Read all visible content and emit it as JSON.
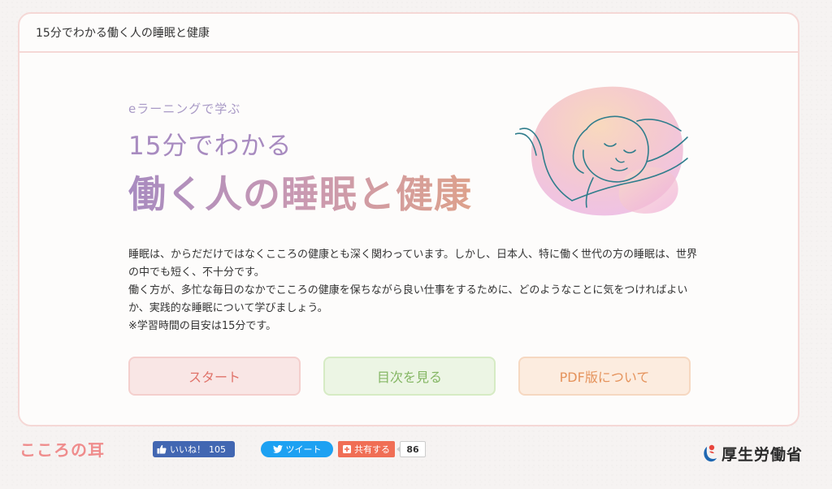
{
  "card": {
    "header_title": "15分でわかる働く人の睡眠と健康"
  },
  "hero": {
    "kicker": "eラーニングで学ぶ",
    "line1": "15分でわかる",
    "line2": "働く人の睡眠と健康"
  },
  "description": {
    "paragraphs": [
      "睡眠は、からだだけではなくこころの健康とも深く関わっています。しかし、日本人、特に働く世代の方の睡眠は、世界の中でも短く、不十分です。",
      "働く方が、多忙な毎日のなかでこころの健康を保ちながら良い仕事をするために、どのようなことに気をつければよいか、実践的な睡眠について学びましょう。",
      "※学習時間の目安は15分です。"
    ]
  },
  "actions": {
    "start_label": "スタート",
    "toc_label": "目次を見る",
    "pdf_label": "PDF版について"
  },
  "footer": {
    "site_logo": "こころの耳",
    "fb_like_label": "いいね！",
    "fb_like_count": "105",
    "tweet_label": "ツイート",
    "share_label": "共有する",
    "share_count": "86",
    "ministry_name": "厚生労働省"
  },
  "colors": {
    "start": "#e0736a",
    "toc": "#84b663",
    "pdf": "#e5935c",
    "logo": "#ef8c8c"
  }
}
